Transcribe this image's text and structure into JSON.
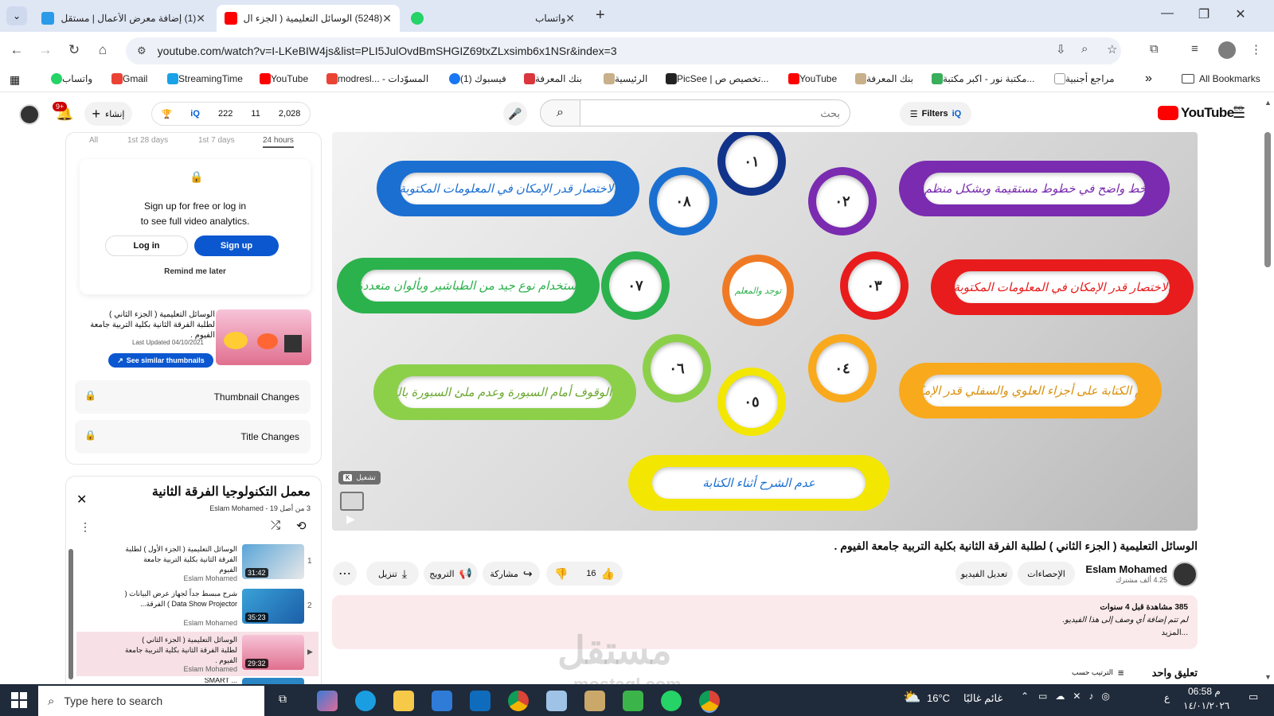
{
  "browser": {
    "tabs": [
      {
        "title": "(1) إضافة معرض الأعمال | مستقل",
        "active": false
      },
      {
        "title": "(5248) الوسائل التعليمية ( الجزء ال",
        "active": true
      },
      {
        "title": "واتساب",
        "active": false
      }
    ],
    "new_tab": "+",
    "url": "youtube.com/watch?v=I-LKeBIW4js&list=PLI5JulOvdBmSHGIZ69txZLxsimb6x1NSr&index=3",
    "bookmarks": [
      "واتساب",
      "Gmail",
      "StreamingTime",
      "YouTube",
      "modresl... - المسوّدات",
      "(1) فيسبوك",
      "بنك المعرفة",
      "الرئيسية",
      "PicSee | تخصيص ص...",
      "YouTube",
      "بنك المعرفة",
      "مكتبة نور - اكبر مكتبة...",
      "مراجع أجنبية"
    ],
    "all_bookmarks": "All Bookmarks",
    "more": "»"
  },
  "yt_header": {
    "logo": "YouTube",
    "logo_sup": "EG",
    "filters": "Filters",
    "search_placeholder": "بحث",
    "stats": {
      "views": "2,028",
      "likes": "11",
      "other": "222"
    },
    "create": "إنشاء",
    "notif_count": "9+"
  },
  "analytics": {
    "tabs": [
      "All",
      "1st 28 days",
      "1st 7 days",
      "24 hours"
    ],
    "signup_line1": "Sign up for free or log in",
    "signup_line2": "to see full video analytics.",
    "login": "Log in",
    "signup": "Sign up",
    "remind": "Remind me later",
    "thumb_title": "الوسائل التعليمية ( الجزء الثاني ) لطلبة الفرقة الثانية بكلية التربية جامعة الفيوم .",
    "last_updated": "Last Updated 04/10/2021",
    "similar": "See similar thumbnails",
    "thumb_changes": "Thumbnail Changes",
    "title_changes": "Title Changes"
  },
  "playlist": {
    "title": "معمل التكنولوجيا الفرقة الثانية",
    "channel": "Eslam Mohamed",
    "position": "3 من أصل 19",
    "items": [
      {
        "index": "1",
        "title": "الوسائل التعليمية ( الجزء الأول ) لطلبة الفرقة الثانية بكلية التربية جامعة الفيوم",
        "author": "Eslam Mohamed",
        "duration": "31:42"
      },
      {
        "index": "2",
        "title": "شرح مبسط جداً لجهاز عرض البيانات ( Data Show Projector ) الفرقة...",
        "author": "Eslam Mohamed",
        "duration": "35:23"
      },
      {
        "index": "▶",
        "title": "الوسائل التعليمية ( الجزء الثاني ) لطلبة الفرقة الثانية بكلية التربية جامعة الفيوم .",
        "author": "Eslam Mohamed",
        "duration": "29:32"
      },
      {
        "index": "",
        "title": "... SMART",
        "author": "",
        "duration": ""
      }
    ]
  },
  "video": {
    "center_label": "توجد والمعلم",
    "petals": [
      {
        "num": "٠١",
        "text": ""
      },
      {
        "num": "٠٢",
        "text": "الكتابة بخط واضح في خطوط مستقيمة وبشكل منظم ومتسق"
      },
      {
        "num": "٠٣",
        "text": "الاختصار قدر الإمكان في المعلومات المكتوبة"
      },
      {
        "num": "٠٤",
        "text": "عدم الكتابة على أجزاء العلوي والسفلي قدر الإمكان"
      },
      {
        "num": "٠٥",
        "text": "عدم الشرح أثناء الكتابة"
      },
      {
        "num": "٠٦",
        "text": "عدم الوقوف أمام السبورة وعدم ملئ السبورة بالكتابة"
      },
      {
        "num": "٠٧",
        "text": "استخدام نوع جيد من الطباشير وبألوان متعددة"
      },
      {
        "num": "٠٨",
        "text": "الاختصار قدر الإمكان في المعلومات المكتوبة"
      }
    ],
    "play_hint": "تشغيل",
    "play_key": "K"
  },
  "video_info": {
    "title": "الوسائل التعليمية ( الجزء الثاني ) لطلبة الفرقة الثانية بكلية التربية جامعة الفيوم .",
    "channel": "Eslam Mohamed",
    "subs": "4.25 ألف مشترك",
    "analytics_btn": "الإحصاءات",
    "edit_btn": "تعديل الفيديو",
    "likes": "16",
    "share": "مشاركة",
    "promote": "الترويج",
    "download": "تنزيل",
    "views_line": "385 مشاهدة  قبل 4 سنوات",
    "desc": "لم تتم إضافة أي وصف إلى هذا الفيديو.",
    "more": "...المزيد",
    "comments_title": "تعليق واحد",
    "sort": "الترتيب حسب"
  },
  "watermark": {
    "main": "مستقل",
    "sub": "mostaql.com"
  },
  "taskbar": {
    "search_placeholder": "Type here to search",
    "temp": "16°C",
    "weather": "غائم غالبًا",
    "time": "06:58 م",
    "date": "١٤/٠١/٢٠٢٦",
    "lang": "ع"
  },
  "colors": {
    "yt_red": "#ff0000",
    "accent_blue": "#065fd4",
    "signup_blue": "#0b57d0",
    "tab_strip": "#dfe7f5",
    "taskbar": "#1f2a3a"
  }
}
